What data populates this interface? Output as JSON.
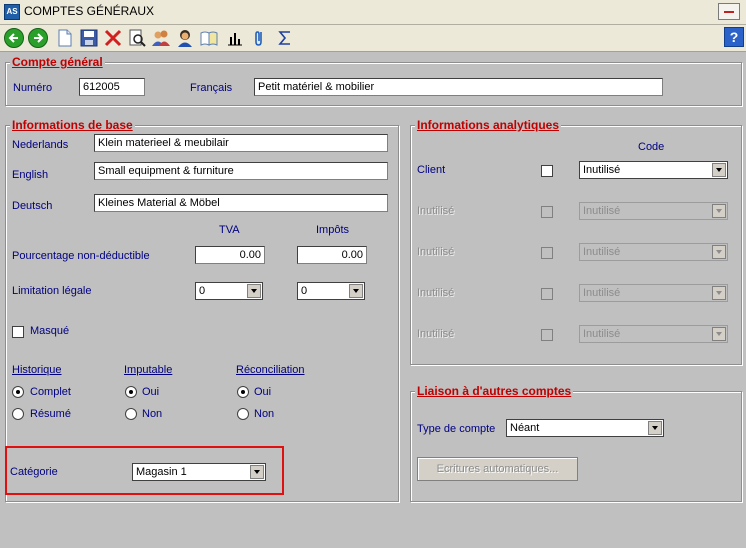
{
  "window": {
    "app_icon_text": "AS",
    "title": "COMPTES GÉNÉRAUX"
  },
  "toolbar": {
    "icons": [
      "back-icon",
      "forward-icon",
      "new-document-icon",
      "save-icon",
      "delete-icon",
      "search-icon",
      "users-icon",
      "user-icon",
      "book-icon",
      "chart-icon",
      "attachment-icon",
      "sum-icon"
    ],
    "help_label": "?"
  },
  "compte_general": {
    "legend": "Compte général",
    "numero_label": "Numéro",
    "numero_value": "612005",
    "francais_label": "Français",
    "francais_value": "Petit matériel & mobilier"
  },
  "infos_base": {
    "legend": "Informations de base",
    "nederlands_label": "Nederlands",
    "nederlands_value": "Klein materieel & meubilair",
    "english_label": "English",
    "english_value": "Small equipment & furniture",
    "deutsch_label": "Deutsch",
    "deutsch_value": "Kleines Material & Möbel",
    "tva_header": "TVA",
    "impots_header": "Impôts",
    "pourcentage_label": "Pourcentage non-déductible",
    "pourcentage_tva": "0.00",
    "pourcentage_impots": "0.00",
    "limitation_label": "Limitation légale",
    "limitation_tva": "0",
    "limitation_impots": "0",
    "masque_label": "Masqué",
    "historique_label": "Historique",
    "historique_complet": "Complet",
    "historique_resume": "Résumé",
    "imputable_label": "Imputable",
    "imputable_oui": "Oui",
    "imputable_non": "Non",
    "reconciliation_label": "Réconciliation",
    "reconciliation_oui": "Oui",
    "reconciliation_non": "Non",
    "categorie_label": "Catégorie",
    "categorie_value": "Magasin 1"
  },
  "infos_analytiques": {
    "legend": "Informations analytiques",
    "code_header": "Code",
    "rows": [
      {
        "label": "Client",
        "value": "Inutilisé",
        "enabled": true
      },
      {
        "label": "Inutilisé",
        "value": "Inutilisé",
        "enabled": false
      },
      {
        "label": "Inutilisé",
        "value": "Inutilisé",
        "enabled": false
      },
      {
        "label": "Inutilisé",
        "value": "Inutilisé",
        "enabled": false
      },
      {
        "label": "Inutilisé",
        "value": "Inutilisé",
        "enabled": false
      }
    ]
  },
  "liaison": {
    "legend": "Liaison à d'autres comptes",
    "type_label": "Type de compte",
    "type_value": "Néant",
    "ecritures_button": "Ecritures automatiques..."
  },
  "colors": {
    "legend": "#c00000",
    "label": "#000080",
    "background": "#c0c0c0",
    "highlight": "#e01010"
  }
}
